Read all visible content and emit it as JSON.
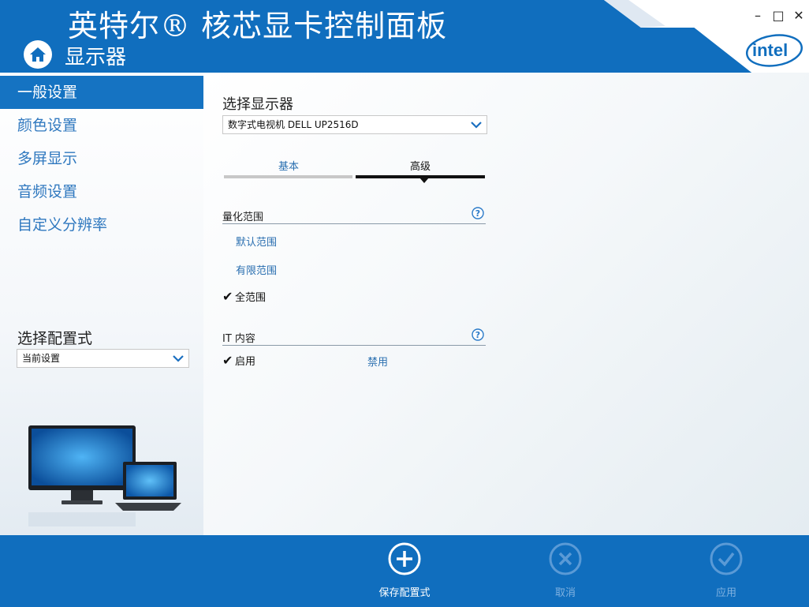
{
  "header": {
    "app_title": "英特尔® 核芯显卡控制面板",
    "section_title": "显示器",
    "logo_text": "intel",
    "window_controls": {
      "minimize": "–",
      "maximize": "□",
      "close": "✕"
    }
  },
  "sidebar": {
    "items": [
      {
        "label": "一般设置",
        "active": true
      },
      {
        "label": "颜色设置",
        "active": false
      },
      {
        "label": "多屏显示",
        "active": false
      },
      {
        "label": "音频设置",
        "active": false
      },
      {
        "label": "自定义分辨率",
        "active": false
      }
    ],
    "profile_label": "选择配置式",
    "profile_value": "当前设置"
  },
  "main": {
    "display_label": "选择显示器",
    "display_value": "数字式电视机 DELL UP2516D",
    "tabs": [
      {
        "label": "基本",
        "active": false
      },
      {
        "label": "高级",
        "active": true
      }
    ],
    "quantization": {
      "title": "量化范围",
      "options": [
        {
          "label": "默认范围",
          "checked": false
        },
        {
          "label": "有限范围",
          "checked": false
        },
        {
          "label": "全范围",
          "checked": true
        }
      ]
    },
    "it_content": {
      "title": "IT 内容",
      "options": [
        {
          "label": "启用",
          "checked": true
        },
        {
          "label": "禁用",
          "checked": false
        }
      ]
    }
  },
  "footer": {
    "save_label": "保存配置式",
    "cancel_label": "取消",
    "apply_label": "应用"
  },
  "colors": {
    "brand_blue": "#106ebe",
    "active_nav": "#1573c2",
    "link_blue": "#2a6fb0"
  }
}
